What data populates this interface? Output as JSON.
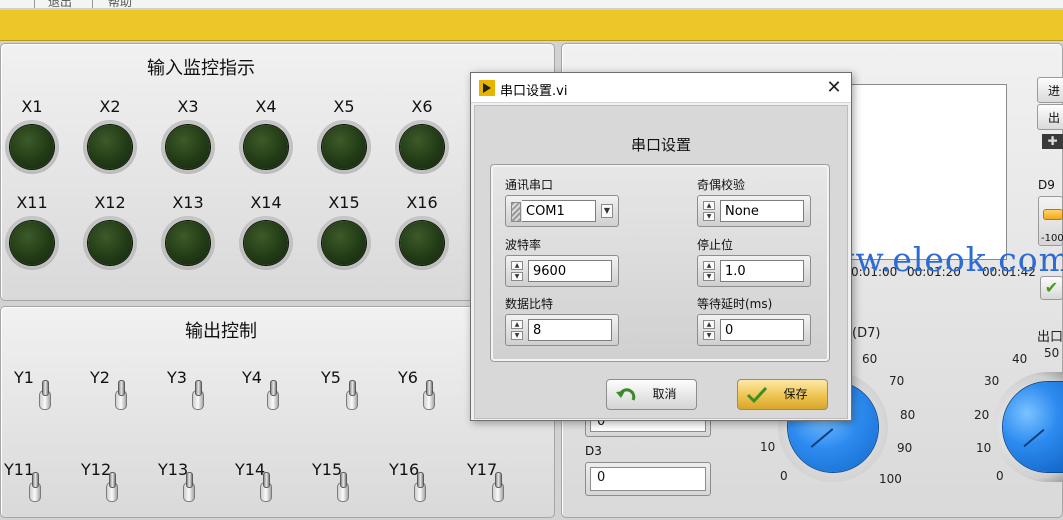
{
  "menu": {
    "items": [
      "退出",
      "帮助"
    ]
  },
  "input_panel": {
    "title": "输入监控指示",
    "leds_row1": [
      "X1",
      "X2",
      "X3",
      "X4",
      "X5",
      "X6"
    ],
    "leds_row2": [
      "X11",
      "X12",
      "X13",
      "X14",
      "X15",
      "X16"
    ]
  },
  "output_panel": {
    "title": "输出控制",
    "switches_row1": [
      "Y1",
      "Y2",
      "Y3",
      "Y4",
      "Y5",
      "Y6"
    ],
    "switches_row2": [
      "Y11",
      "Y12",
      "Y13",
      "Y14",
      "Y15",
      "Y16",
      "Y17"
    ]
  },
  "right_panel": {
    "time_ticks": [
      "0:01:00",
      "00:01:20",
      "00:01:42"
    ],
    "btn_top": "进",
    "btn_mid": "出",
    "d9_label": "D9",
    "d9_value": "-100",
    "d3_label": "D3",
    "d3_value": "0",
    "d_upper_value": "0",
    "knob1_label": "(D7)",
    "knob2_label": "出口",
    "knob1_ticks": [
      "60",
      "70",
      "80",
      "90",
      "100",
      "10",
      "0"
    ],
    "knob2_ticks": [
      "40",
      "50",
      "30",
      "20",
      "10",
      "0"
    ]
  },
  "watermark": "www.eleok.com",
  "dialog": {
    "title": "串口设置.vi",
    "heading": "串口设置",
    "fields": {
      "com_port": {
        "label": "通讯串口",
        "value": "COM1"
      },
      "parity": {
        "label": "奇偶校验",
        "value": "None"
      },
      "baud": {
        "label": "波特率",
        "value": "9600"
      },
      "stop_bits": {
        "label": "停止位",
        "value": "1.0"
      },
      "data_bits": {
        "label": "数据比特",
        "value": "8"
      },
      "wait_delay": {
        "label": "等待延时(ms)",
        "value": "0"
      }
    },
    "cancel_label": "取消",
    "save_label": "保存"
  }
}
